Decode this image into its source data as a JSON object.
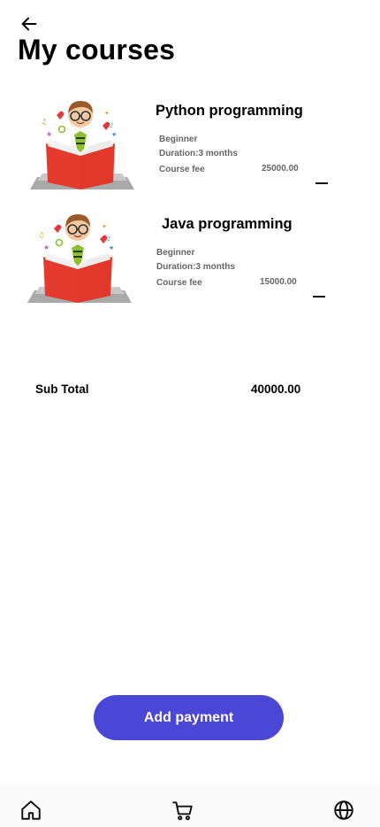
{
  "header": {
    "back_icon": "arrow-left-icon",
    "title": "My courses"
  },
  "courses": [
    {
      "name": "Python programming",
      "level": "Beginner",
      "duration": "Duration:3 months",
      "fee_label": "Course fee",
      "fee_value": "25000.00",
      "remove_icon": "minus-icon"
    },
    {
      "name": "Java programming",
      "level": "Beginner",
      "duration": "Duration:3 months",
      "fee_label": "Course fee",
      "fee_value": "15000.00",
      "remove_icon": "minus-icon"
    }
  ],
  "summary": {
    "subtotal_label": "Sub Total",
    "subtotal_value": "40000.00"
  },
  "actions": {
    "add_payment_label": "Add payment",
    "button_color": "#4a46d6"
  },
  "bottom_nav": {
    "items": [
      "home-icon",
      "cart-icon",
      "globe-icon"
    ]
  }
}
